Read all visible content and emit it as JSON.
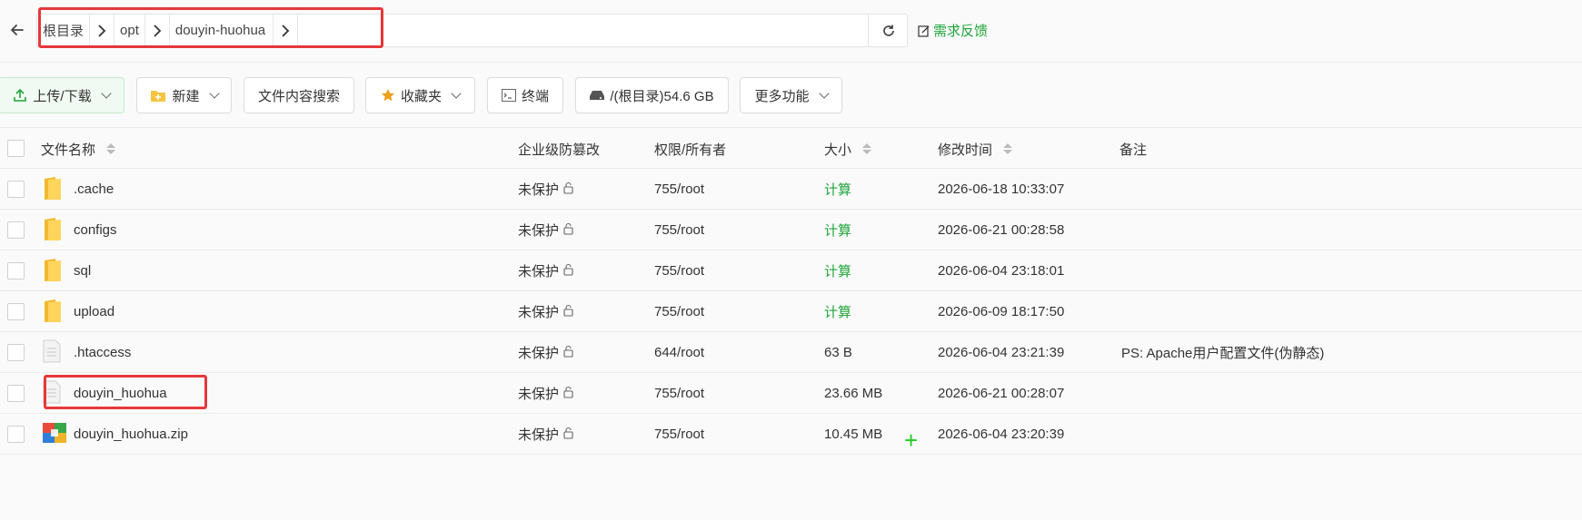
{
  "breadcrumb": {
    "items": [
      "根目录",
      "opt",
      "douyin-huohua"
    ]
  },
  "feedback_label": "需求反馈",
  "toolbar": {
    "upload": "上传/下载",
    "new": "新建",
    "search_content": "文件内容搜索",
    "favorites": "收藏夹",
    "terminal": "终端",
    "disk": "/(根目录)54.6 GB",
    "more": "更多功能"
  },
  "table": {
    "headers": {
      "name": "文件名称",
      "protect": "企业级防篡改",
      "perm": "权限/所有者",
      "size": "大小",
      "mtime": "修改时间",
      "note": "备注"
    },
    "rows": [
      {
        "type": "folder",
        "name": ".cache",
        "protect": "未保护",
        "perm": "755/root",
        "size": "计算",
        "mtime": "2026-06-18 10:33:07",
        "note": ""
      },
      {
        "type": "folder",
        "name": "configs",
        "protect": "未保护",
        "perm": "755/root",
        "size": "计算",
        "mtime": "2026-06-21 00:28:58",
        "note": ""
      },
      {
        "type": "folder",
        "name": "sql",
        "protect": "未保护",
        "perm": "755/root",
        "size": "计算",
        "mtime": "2026-06-04 23:18:01",
        "note": ""
      },
      {
        "type": "folder",
        "name": "upload",
        "protect": "未保护",
        "perm": "755/root",
        "size": "计算",
        "mtime": "2026-06-09 18:17:50",
        "note": ""
      },
      {
        "type": "file",
        "name": ".htaccess",
        "protect": "未保护",
        "perm": "644/root",
        "size": "63 B",
        "mtime": "2026-06-04 23:21:39",
        "note": "PS: Apache用户配置文件(伪静态)"
      },
      {
        "type": "file",
        "name": "douyin_huohua",
        "protect": "未保护",
        "perm": "755/root",
        "size": "23.66 MB",
        "mtime": "2026-06-21 00:28:07",
        "note": ""
      },
      {
        "type": "zip",
        "name": "douyin_huohua.zip",
        "protect": "未保护",
        "perm": "755/root",
        "size": "10.45 MB",
        "mtime": "2026-06-04 23:20:39",
        "note": ""
      }
    ]
  },
  "colors": {
    "accent": "#20a53a",
    "highlight": "#e5383b",
    "folder": "#f5c443"
  }
}
